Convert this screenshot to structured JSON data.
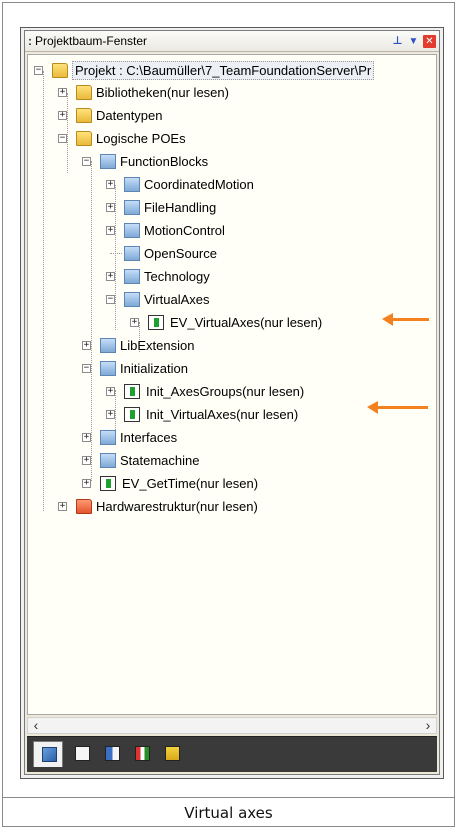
{
  "window": {
    "title": "Projektbaum-Fenster",
    "grip": ":",
    "pin_glyph": "⊥",
    "menu_glyph": "▼",
    "close_glyph": "✕"
  },
  "tree": {
    "root_label": "Projekt : C:\\Baumüller\\7_TeamFoundationServer\\Pr",
    "bibliotheken": "Bibliotheken(nur lesen)",
    "datentypen": "Datentypen",
    "logische_poes": "Logische POEs",
    "function_blocks": "FunctionBlocks",
    "coordinated_motion": "CoordinatedMotion",
    "file_handling": "FileHandling",
    "motion_control": "MotionControl",
    "open_source": "OpenSource",
    "technology": "Technology",
    "virtual_axes": "VirtualAxes",
    "ev_virtual_axes": "EV_VirtualAxes(nur lesen)",
    "lib_extension": "LibExtension",
    "initialization": "Initialization",
    "init_axes_groups": "Init_AxesGroups(nur lesen)",
    "init_virtual_axes": "Init_VirtualAxes(nur lesen)",
    "interfaces": "Interfaces",
    "statemachine": "Statemachine",
    "ev_get_time": "EV_GetTime(nur lesen)",
    "hardwarestruktur": "Hardwarestruktur(nur lesen)"
  },
  "expander": {
    "plus": "+",
    "minus": "−"
  },
  "scrollbar": {
    "left": "‹",
    "right": "›"
  },
  "caption": "Virtual axes",
  "colors": {
    "highlight_arrow": "#f4811f",
    "toolbar_bg": "#3a3a3a"
  }
}
